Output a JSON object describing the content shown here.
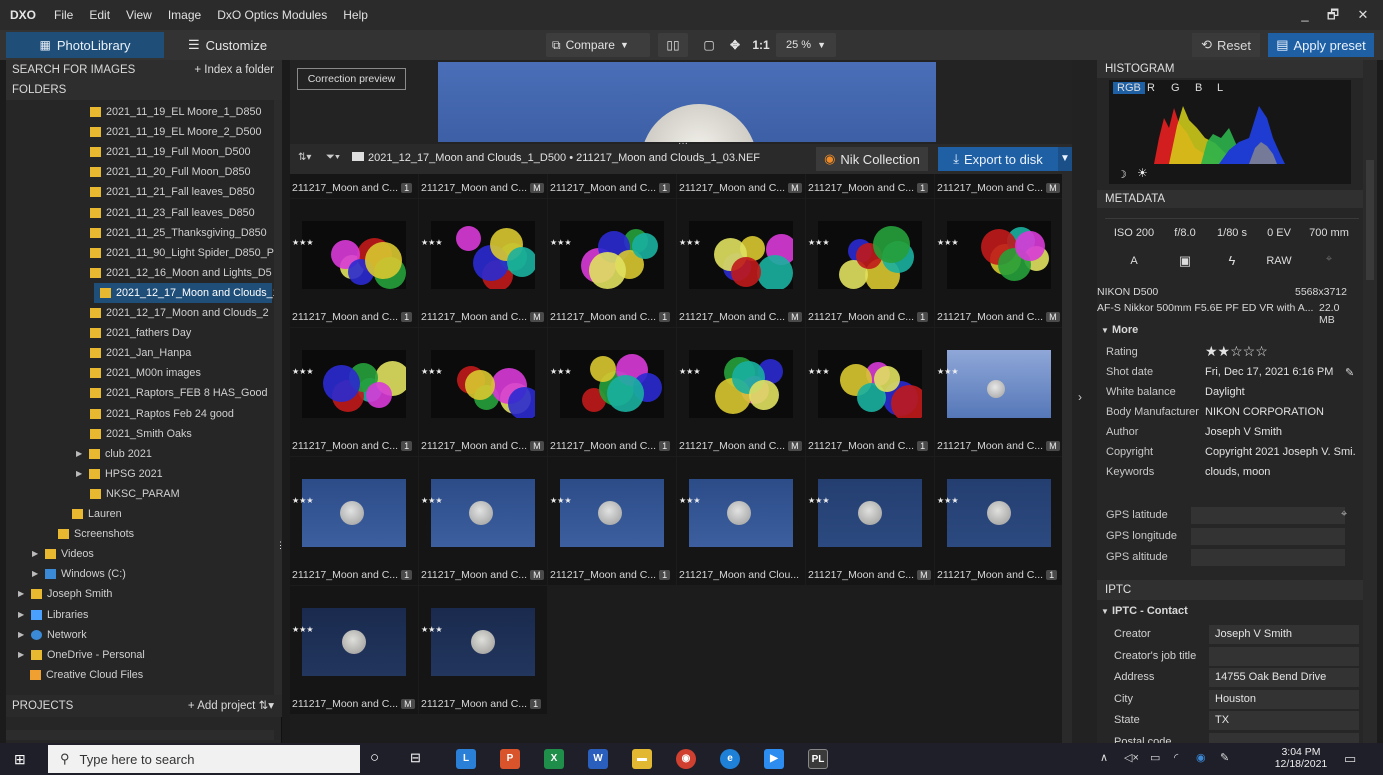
{
  "menubar": {
    "logo": "DXO",
    "items": [
      "File",
      "Edit",
      "View",
      "Image",
      "DxO Optics Modules",
      "Help"
    ],
    "win_min": "_",
    "win_restore": "🗗",
    "win_close": "✕"
  },
  "toolbar": {
    "photolibrary": "PhotoLibrary",
    "customize": "Customize",
    "compare": "Compare",
    "one_to_one": "1:1",
    "zoom": "25 %",
    "reset": "Reset",
    "apply_preset": "Apply preset"
  },
  "left": {
    "search_label": "SEARCH FOR IMAGES",
    "index_folder": "+ Index a folder",
    "folders_label": "FOLDERS",
    "projects_label": "PROJECTS",
    "add_project": "+ Add project",
    "tree": [
      {
        "label": "2021_11_19_EL Moore_1_D850",
        "indent": 94,
        "type": "folder"
      },
      {
        "label": "2021_11_19_EL Moore_2_D500",
        "indent": 94,
        "type": "folder"
      },
      {
        "label": "2021_11_19_Full Moon_D500",
        "indent": 94,
        "type": "folder"
      },
      {
        "label": "2021_11_20_Full Moon_D850",
        "indent": 94,
        "type": "folder"
      },
      {
        "label": "2021_11_21_Fall leaves_D850",
        "indent": 94,
        "type": "folder"
      },
      {
        "label": "2021_11_23_Fall leaves_D850",
        "indent": 94,
        "type": "folder"
      },
      {
        "label": "2021_11_25_Thanksgiving_D850",
        "indent": 94,
        "type": "folder"
      },
      {
        "label": "2021_11_90_Light Spider_D850_P",
        "indent": 94,
        "type": "folder"
      },
      {
        "label": "2021_12_16_Moon and Lights_D5",
        "indent": 94,
        "type": "folder"
      },
      {
        "label": "2021_12_17_Moon and Clouds_1",
        "indent": 94,
        "type": "folder",
        "selected": true
      },
      {
        "label": "2021_12_17_Moon and Clouds_2",
        "indent": 94,
        "type": "folder"
      },
      {
        "label": "2021_fathers Day",
        "indent": 94,
        "type": "folder"
      },
      {
        "label": "2021_Jan_Hanpa",
        "indent": 94,
        "type": "folder"
      },
      {
        "label": "2021_M00n images",
        "indent": 94,
        "type": "folder"
      },
      {
        "label": "2021_Raptors_FEB 8 HAS_Good",
        "indent": 94,
        "type": "folder"
      },
      {
        "label": "2021_Raptos Feb 24 good",
        "indent": 94,
        "type": "folder"
      },
      {
        "label": "2021_Smith Oaks",
        "indent": 94,
        "type": "folder"
      },
      {
        "label": "club 2021",
        "indent": 80,
        "type": "folder",
        "arrow": true
      },
      {
        "label": "HPSG 2021",
        "indent": 80,
        "type": "folder",
        "arrow": true
      },
      {
        "label": "NKSC_PARAM",
        "indent": 94,
        "type": "folder"
      },
      {
        "label": "Lauren",
        "indent": 76,
        "type": "folder"
      },
      {
        "label": "Screenshots",
        "indent": 62,
        "type": "folder"
      },
      {
        "label": "Videos",
        "indent": 36,
        "type": "folder",
        "arrow": true
      },
      {
        "label": "Windows (C:)",
        "indent": 36,
        "type": "drive",
        "arrow": true
      },
      {
        "label": "Joseph Smith",
        "indent": 22,
        "type": "folder",
        "arrow": true
      },
      {
        "label": "Libraries",
        "indent": 22,
        "type": "lib",
        "arrow": true
      },
      {
        "label": "Network",
        "indent": 22,
        "type": "net",
        "arrow": true
      },
      {
        "label": "OneDrive - Personal",
        "indent": 22,
        "type": "folder",
        "arrow": true
      },
      {
        "label": "Creative Cloud Files",
        "indent": 34,
        "type": "cc"
      }
    ]
  },
  "center": {
    "correction_preview": "Correction preview",
    "path": "2021_12_17_Moon and Clouds_1_D500  •  211217_Moon and Clouds_1_03.NEF",
    "nik": "Nik Collection",
    "export": "Export to disk",
    "thumbs": [
      {
        "cap": "211217_Moon and C...",
        "badge": "1",
        "kind": "bokeh"
      },
      {
        "cap": "211217_Moon and C...",
        "badge": "M",
        "kind": "bokeh"
      },
      {
        "cap": "211217_Moon and C...",
        "badge": "1",
        "kind": "bokeh"
      },
      {
        "cap": "211217_Moon and C...",
        "badge": "M",
        "kind": "bokeh"
      },
      {
        "cap": "211217_Moon and C...",
        "badge": "1",
        "kind": "bokeh"
      },
      {
        "cap": "211217_Moon and C...",
        "badge": "M",
        "kind": "bokeh"
      },
      {
        "cap": "211217_Moon and C...",
        "badge": "1",
        "kind": "bokeh"
      },
      {
        "cap": "211217_Moon and C...",
        "badge": "M",
        "kind": "bokeh"
      },
      {
        "cap": "211217_Moon and C...",
        "badge": "1",
        "kind": "bokeh"
      },
      {
        "cap": "211217_Moon and C...",
        "badge": "M",
        "kind": "bokeh"
      },
      {
        "cap": "211217_Moon and C...",
        "badge": "1",
        "kind": "bokeh"
      },
      {
        "cap": "211217_Moon and C...",
        "badge": "M",
        "kind": "bokeh"
      },
      {
        "cap": "211217_Moon and C...",
        "badge": "1",
        "kind": "bokeh"
      },
      {
        "cap": "211217_Moon and C...",
        "badge": "M",
        "kind": "bokeh"
      },
      {
        "cap": "211217_Moon and C...",
        "badge": "1",
        "kind": "bokeh"
      },
      {
        "cap": "211217_Moon and C...",
        "badge": "M",
        "kind": "bokeh"
      },
      {
        "cap": "211217_Moon and C...",
        "badge": "1",
        "kind": "bokeh"
      },
      {
        "cap": "211217_Moon and C...",
        "badge": "M",
        "kind": "moonlight"
      },
      {
        "cap": "211217_Moon and C...",
        "badge": "1",
        "kind": "moon"
      },
      {
        "cap": "211217_Moon and C...",
        "badge": "M",
        "kind": "moon"
      },
      {
        "cap": "211217_Moon and C...",
        "badge": "1",
        "kind": "moon"
      },
      {
        "cap": "211217_Moon and Clou...",
        "badge": "",
        "kind": "moon"
      },
      {
        "cap": "211217_Moon and C...",
        "badge": "M",
        "kind": "moondark"
      },
      {
        "cap": "211217_Moon and C...",
        "badge": "1",
        "kind": "moondark"
      },
      {
        "cap": "211217_Moon and C...",
        "badge": "M",
        "kind": "moonnight"
      },
      {
        "cap": "211217_Moon and C...",
        "badge": "1",
        "kind": "moonnight"
      }
    ]
  },
  "right": {
    "histogram_label": "HISTOGRAM",
    "hist_tabs": [
      "RGB",
      "R",
      "G",
      "B",
      "L"
    ],
    "metadata_label": "METADATA",
    "exif1": [
      "ISO 200",
      "f/8.0",
      "1/80 s",
      "0 EV",
      "700 mm"
    ],
    "exif2": [
      "A",
      "RAW"
    ],
    "camera": "NIKON D500",
    "dims": "5568x3712",
    "lens": "AF-S Nikkor 500mm F5.6E PF ED VR with A...",
    "size": "22.0 MB",
    "more_label": "More",
    "rows": [
      {
        "k": "Rating",
        "v": "★★☆☆☆"
      },
      {
        "k": "Shot date",
        "v": "Fri, Dec 17, 2021 6:16 PM"
      },
      {
        "k": "White balance",
        "v": "Daylight"
      },
      {
        "k": "Body Manufacturer",
        "v": "NIKON CORPORATION"
      },
      {
        "k": "Author",
        "v": "Joseph V Smith"
      },
      {
        "k": "Copyright",
        "v": "Copyright 2021  Joseph V. Smi..."
      },
      {
        "k": "Keywords",
        "v": "clouds, moon"
      }
    ],
    "gps": [
      "GPS latitude",
      "GPS longitude",
      "GPS altitude"
    ],
    "iptc_label": "IPTC",
    "iptc_contact": "IPTC - Contact",
    "iptc_rows": [
      {
        "k": "Creator",
        "v": "Joseph V Smith"
      },
      {
        "k": "Creator's job title",
        "v": ""
      },
      {
        "k": "Address",
        "v": "14755 Oak Bend Drive"
      },
      {
        "k": "City",
        "v": "Houston"
      },
      {
        "k": "State",
        "v": "TX"
      },
      {
        "k": "Postal code",
        "v": ""
      }
    ]
  },
  "taskbar": {
    "search": "Type here to search",
    "time": "3:04 PM",
    "date": "12/18/2021"
  }
}
